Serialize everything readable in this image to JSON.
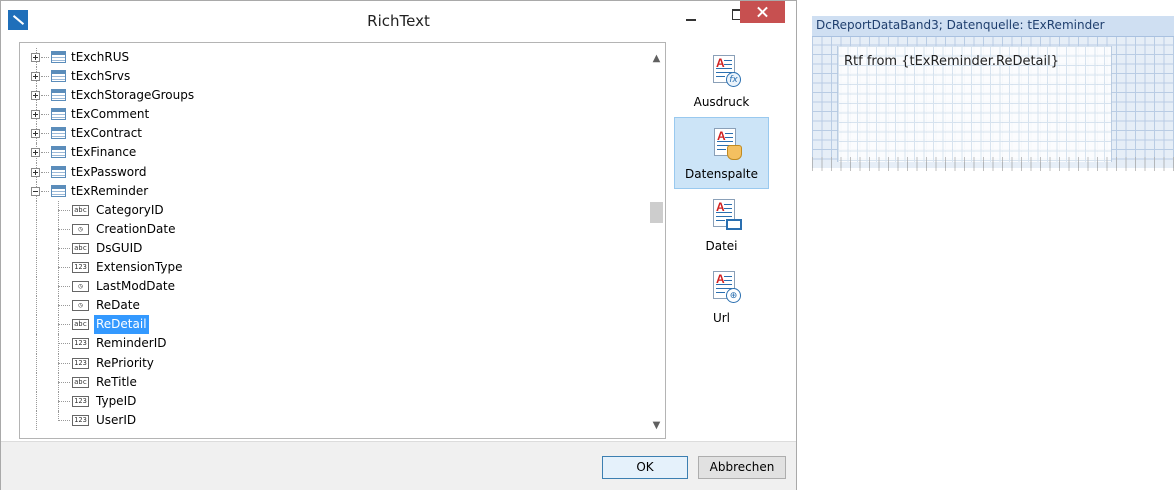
{
  "dialog": {
    "title": "RichText",
    "tree": {
      "tables": [
        {
          "label": "tExchRUS",
          "expanded": false
        },
        {
          "label": "tExchSrvs",
          "expanded": false
        },
        {
          "label": "tExchStorageGroups",
          "expanded": false
        },
        {
          "label": "tExComment",
          "expanded": false
        },
        {
          "label": "tExContract",
          "expanded": false
        },
        {
          "label": "tExFinance",
          "expanded": false
        },
        {
          "label": "tExPassword",
          "expanded": false
        },
        {
          "label": "tExReminder",
          "expanded": true
        }
      ],
      "fields": [
        {
          "label": "CategoryID",
          "type": "abc",
          "selected": false
        },
        {
          "label": "CreationDate",
          "type": "clock",
          "selected": false
        },
        {
          "label": "DsGUID",
          "type": "abc",
          "selected": false
        },
        {
          "label": "ExtensionType",
          "type": "123",
          "selected": false
        },
        {
          "label": "LastModDate",
          "type": "clock",
          "selected": false
        },
        {
          "label": "ReDate",
          "type": "clock",
          "selected": false
        },
        {
          "label": "ReDetail",
          "type": "abc",
          "selected": true
        },
        {
          "label": "ReminderID",
          "type": "123",
          "selected": false
        },
        {
          "label": "RePriority",
          "type": "123",
          "selected": false
        },
        {
          "label": "ReTitle",
          "type": "abc",
          "selected": false
        },
        {
          "label": "TypeID",
          "type": "123",
          "selected": false
        },
        {
          "label": "UserID",
          "type": "123",
          "selected": false
        }
      ]
    },
    "source_types": [
      {
        "label": "Ausdruck",
        "icon": "expression-icon",
        "active": false
      },
      {
        "label": "Datenspalte",
        "icon": "data-column-icon",
        "active": true
      },
      {
        "label": "Datei",
        "icon": "file-icon",
        "active": false
      },
      {
        "label": "Url",
        "icon": "url-icon",
        "active": false
      }
    ],
    "buttons": {
      "ok": "OK",
      "cancel": "Abbrechen"
    }
  },
  "designer": {
    "band_title": "DcReportDataBand3; Datenquelle: tExReminder",
    "rtf_text": "Rtf from {tExReminder.ReDetail}"
  },
  "colors": {
    "selection": "#3399ff",
    "close_button": "#c75050",
    "active_type": "#cce4f7"
  }
}
